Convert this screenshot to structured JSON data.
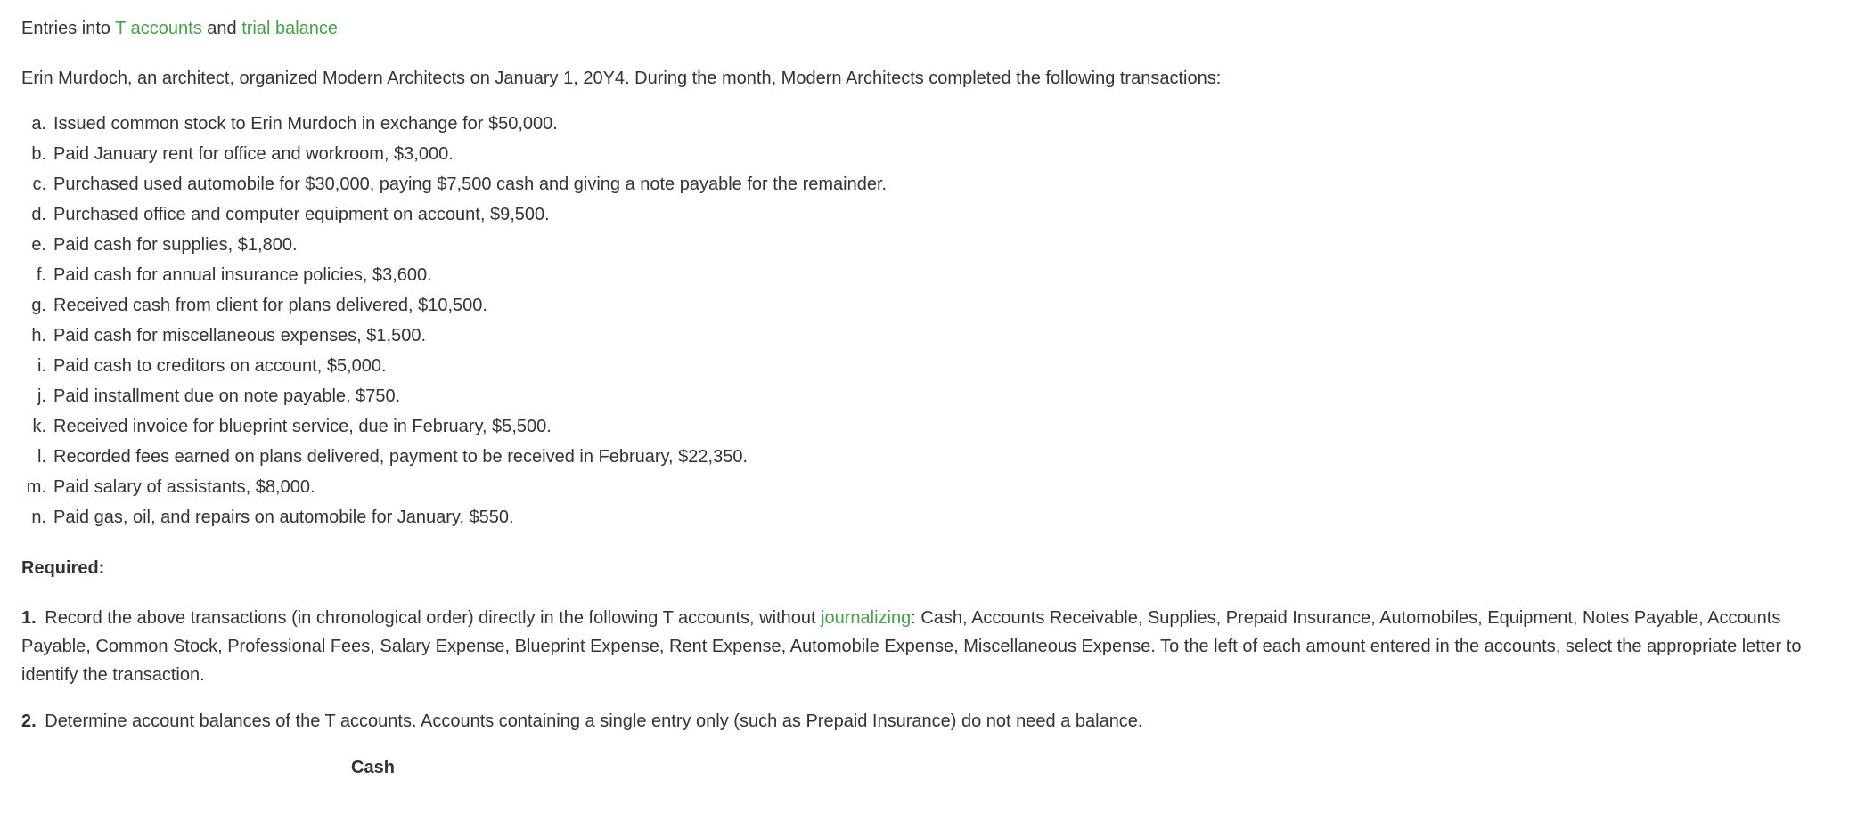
{
  "title": {
    "prefix": "Entries into ",
    "link1": "T accounts",
    "mid": " and ",
    "link2": "trial balance"
  },
  "intro": "Erin Murdoch, an architect, organized Modern Architects on January 1, 20Y4. During the month, Modern Architects completed the following transactions:",
  "transactions": [
    {
      "letter": "a.",
      "text": "Issued common stock to Erin Murdoch in exchange for $50,000."
    },
    {
      "letter": "b.",
      "text": "Paid January rent for office and workroom, $3,000."
    },
    {
      "letter": "c.",
      "text": "Purchased used automobile for $30,000, paying $7,500 cash and giving a note payable for the remainder."
    },
    {
      "letter": "d.",
      "text": "Purchased office and computer equipment on account, $9,500."
    },
    {
      "letter": "e.",
      "text": "Paid cash for supplies, $1,800."
    },
    {
      "letter": "f.",
      "text": "Paid cash for annual insurance policies, $3,600."
    },
    {
      "letter": "g.",
      "text": "Received cash from client for plans delivered, $10,500."
    },
    {
      "letter": "h.",
      "text": "Paid cash for miscellaneous expenses, $1,500."
    },
    {
      "letter": "i.",
      "text": "Paid cash to creditors on account, $5,000."
    },
    {
      "letter": "j.",
      "text": "Paid installment due on note payable, $750."
    },
    {
      "letter": "k.",
      "text": "Received invoice for blueprint service, due in February, $5,500."
    },
    {
      "letter": "l.",
      "text": "Recorded fees earned on plans delivered, payment to be received in February, $22,350."
    },
    {
      "letter": "m.",
      "text": "Paid salary of assistants, $8,000."
    },
    {
      "letter": "n.",
      "text": "Paid gas, oil, and repairs on automobile for January, $550."
    }
  ],
  "required_label": "Required:",
  "req1": {
    "num": "1.",
    "before": "  Record the above transactions (in chronological order) directly in the following T accounts, without ",
    "link": "journalizing",
    "after": ": Cash, Accounts Receivable, Supplies, Prepaid Insurance, Automobiles, Equipment, Notes Payable, Accounts Payable, Common Stock, Professional Fees, Salary Expense, Blueprint Expense, Rent Expense, Automobile Expense, Miscellaneous Expense. To the left of each amount entered in the accounts, select the appropriate letter to identify the transaction."
  },
  "req2": {
    "num": "2.",
    "text": "  Determine account balances of the T accounts. Accounts containing a single entry only (such as Prepaid Insurance) do not need a balance."
  },
  "cash_header": "Cash"
}
